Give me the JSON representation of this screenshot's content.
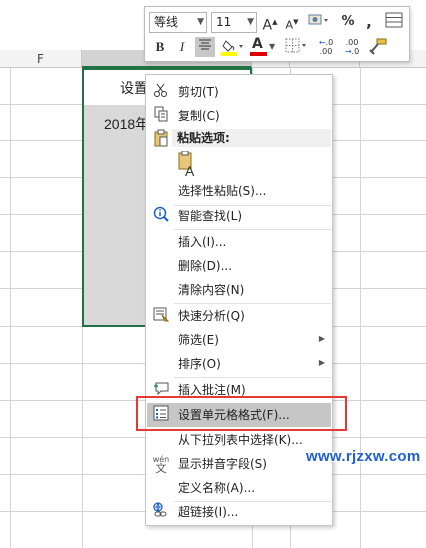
{
  "spreadsheet": {
    "column_headers": [
      "F",
      "",
      "",
      "",
      ""
    ],
    "cells": {
      "header_cell": "设置",
      "date_cell": "2018年"
    }
  },
  "mini_toolbar": {
    "font_name": "等线",
    "font_size": "11",
    "increase_font": "A",
    "decrease_font": "A",
    "percent": "%",
    "comma": ",",
    "bold": "B",
    "italic": "I",
    "font_color_letter": "A",
    "decimal_increase": "←.0\n.00",
    "decimal_decrease": ".00\n→.0",
    "colors": {
      "highlight": "#ffff00",
      "font_color": "#e00000"
    }
  },
  "context_menu": {
    "items": [
      {
        "id": "cut",
        "label": "剪切(T)",
        "icon": "scissors-icon"
      },
      {
        "id": "copy",
        "label": "复制(C)",
        "icon": "copy-icon"
      },
      {
        "id": "paste_section",
        "label": "粘贴选项:",
        "icon": "clipboard-icon"
      },
      {
        "id": "paste_special",
        "label": "选择性粘贴(S)...",
        "icon": ""
      },
      {
        "id": "smart_lookup",
        "label": "智能查找(L)",
        "icon": "smart-lookup-icon"
      },
      {
        "id": "insert",
        "label": "插入(I)...",
        "icon": ""
      },
      {
        "id": "delete",
        "label": "删除(D)...",
        "icon": ""
      },
      {
        "id": "clear",
        "label": "清除内容(N)",
        "icon": ""
      },
      {
        "id": "quick_analysis",
        "label": "快速分析(Q)",
        "icon": "quick-analysis-icon"
      },
      {
        "id": "filter",
        "label": "筛选(E)",
        "icon": "",
        "submenu": true
      },
      {
        "id": "sort",
        "label": "排序(O)",
        "icon": "",
        "submenu": true
      },
      {
        "id": "insert_comment",
        "label": "插入批注(M)",
        "icon": "comment-icon"
      },
      {
        "id": "format_cells",
        "label": "设置单元格格式(F)...",
        "icon": "format-cells-icon"
      },
      {
        "id": "pick_list",
        "label": "从下拉列表中选择(K)...",
        "icon": ""
      },
      {
        "id": "phonetic",
        "label": "显示拼音字段(S)",
        "icon": "phonetic-icon"
      },
      {
        "id": "define_name",
        "label": "定义名称(A)...",
        "icon": ""
      },
      {
        "id": "hyperlink",
        "label": "超链接(I)...",
        "icon": "hyperlink-icon"
      }
    ],
    "phonetic_icon_text": "wén",
    "phonetic_icon_char": "文"
  },
  "watermark": "www.rjzxw.com"
}
